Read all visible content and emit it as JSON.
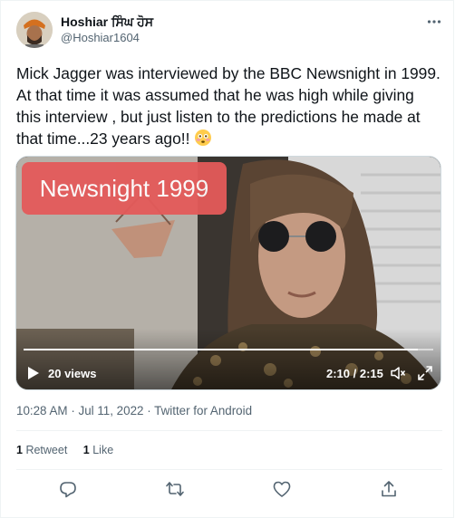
{
  "author": {
    "name": "Hoshiar ਸਿੰਘ ਹੋਸ",
    "handle": "@Hoshiar1604"
  },
  "tweet": {
    "text": "Mick Jagger was interviewed by the BBC Newsnight in 1999. At that time it was assumed that he was high while giving this interview , but just listen to the predictions he made at that time...23 years ago!!",
    "emoji": "flushed-face"
  },
  "video": {
    "overlay_label": "Newsnight 1999",
    "views": "20 views",
    "time": "2:10 / 2:15",
    "progress": 0.963
  },
  "meta": {
    "time": "10:28 AM",
    "date": "Jul 11, 2022",
    "source": "Twitter for Android"
  },
  "stats": {
    "retweets_count": "1",
    "retweets_label": "Retweet",
    "likes_count": "1",
    "likes_label": "Like"
  },
  "icons": [
    "more-icon",
    "play-icon",
    "volume-icon",
    "expand-icon",
    "reply-icon",
    "retweet-icon",
    "like-icon",
    "share-icon"
  ],
  "colors": {
    "text": "#0f1419",
    "secondary": "#536471",
    "overlay": "#e45a5a",
    "border": "#eff3f4"
  }
}
